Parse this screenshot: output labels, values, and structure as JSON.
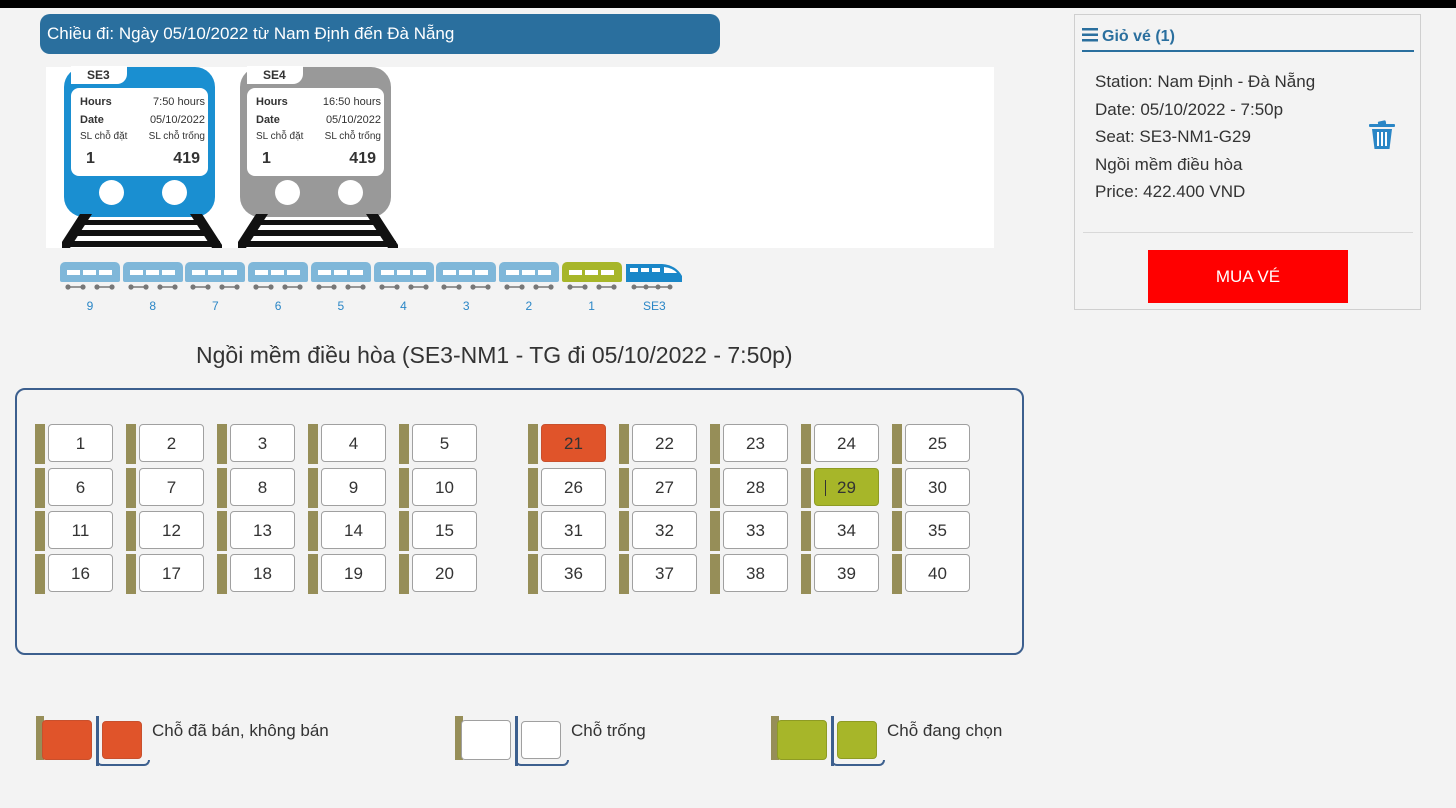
{
  "route_header": "Chiều đi: Ngày 05/10/2022 từ Nam Định đến Đà Nẵng",
  "trains": [
    {
      "code": "SE3",
      "hours_label": "Hours",
      "hours": "7:50 hours",
      "date_label": "Date",
      "date": "05/10/2022",
      "booked_label": "SL chỗ đặt",
      "free_label": "SL chỗ trống",
      "booked": "1",
      "free": "419",
      "color": "#1a8fd1",
      "state": "selected"
    },
    {
      "code": "SE4",
      "hours_label": "Hours",
      "hours": "16:50 hours",
      "date_label": "Date",
      "date": "05/10/2022",
      "booked_label": "SL chỗ đặt",
      "free_label": "SL chỗ trống",
      "booked": "1",
      "free": "419",
      "color": "#999999",
      "state": "inactive"
    }
  ],
  "coaches": [
    {
      "label": "9",
      "type": "car",
      "active": false
    },
    {
      "label": "8",
      "type": "car",
      "active": false
    },
    {
      "label": "7",
      "type": "car",
      "active": false
    },
    {
      "label": "6",
      "type": "car",
      "active": false
    },
    {
      "label": "5",
      "type": "car",
      "active": false
    },
    {
      "label": "4",
      "type": "car",
      "active": false
    },
    {
      "label": "3",
      "type": "car",
      "active": false
    },
    {
      "label": "2",
      "type": "car",
      "active": false
    },
    {
      "label": "1",
      "type": "car",
      "active": true
    },
    {
      "label": "SE3",
      "type": "locomotive",
      "active": false
    }
  ],
  "carriage_title": "Ngồi mềm điều hòa (SE3-NM1 - TG đi 05/10/2022 - 7:50p)",
  "seats": {
    "left_block": [
      [
        "1",
        "2",
        "3",
        "4",
        "5"
      ],
      [
        "6",
        "7",
        "8",
        "9",
        "10"
      ],
      [
        "11",
        "12",
        "13",
        "14",
        "15"
      ],
      [
        "16",
        "17",
        "18",
        "19",
        "20"
      ]
    ],
    "right_block": [
      [
        "21",
        "22",
        "23",
        "24",
        "25"
      ],
      [
        "26",
        "27",
        "28",
        "29",
        "30"
      ],
      [
        "31",
        "32",
        "33",
        "34",
        "35"
      ],
      [
        "36",
        "37",
        "38",
        "39",
        "40"
      ]
    ],
    "sold": [
      "21"
    ],
    "selected": [
      "29"
    ]
  },
  "legend": {
    "sold": "Chỗ đã bán, không bán",
    "free": "Chỗ trống",
    "selecting": "Chỗ đang chọn"
  },
  "colors": {
    "sold": "#e0542a",
    "selected": "#a7b629",
    "free": "#ffffff",
    "seat_back": "#968e58",
    "header_blue": "#2a6f9e",
    "buy": "#ff0000"
  },
  "cart": {
    "title": "Giỏ vé (1)",
    "station": "Station: Nam Định - Đà Nẵng",
    "date": "Date: 05/10/2022 - 7:50p",
    "seat": "Seat: SE3-NM1-G29",
    "seat_type": "Ngồi mềm điều hòa",
    "price": "Price: 422.400 VND",
    "buy_label": "MUA VÉ"
  }
}
